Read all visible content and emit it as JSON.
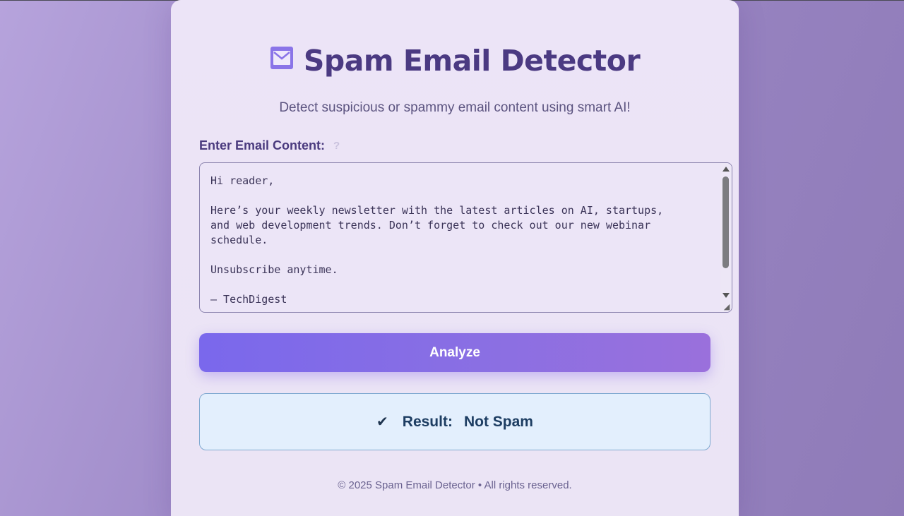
{
  "header": {
    "title": "Spam Email Detector",
    "subtitle": "Detect suspicious or spammy email content using smart AI!",
    "icon": "envelope-icon"
  },
  "form": {
    "label": "Enter Email Content:",
    "help_icon": "help-icon",
    "email_content": "Hi reader,\n\nHere’s your weekly newsletter with the latest articles on AI, startups,\nand web development trends. Don’t forget to check out our new webinar\nschedule.\n\nUnsubscribe anytime.\n\n— TechDigest",
    "analyze_label": "Analyze"
  },
  "result": {
    "icon": "checkmark-icon",
    "label": "Result:",
    "value": "Not Spam"
  },
  "footer": {
    "text": "© 2025 Spam Email Detector • All rights reserved."
  },
  "colors": {
    "accent": "#7a68ec",
    "title": "#4b3a82",
    "result_bg": "#e3effd",
    "result_border": "#7fa9d0"
  }
}
